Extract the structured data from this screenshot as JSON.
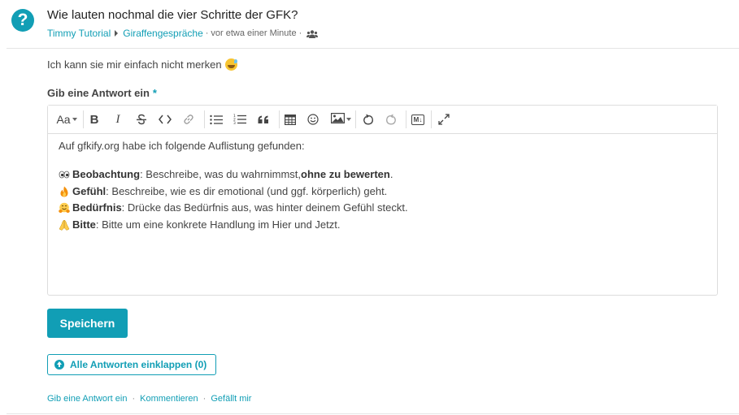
{
  "question": {
    "icon": "question-circle-icon",
    "title": "Wie lauten nochmal die vier Schritte der GFK?",
    "author": "Timmy Tutorial",
    "category": "Giraffengespräche",
    "time": "vor etwa einer Minute",
    "visibility_icon": "group-icon",
    "body": "Ich kann sie mir einfach nicht merken",
    "body_emoji": "grinning-sweat-emoji"
  },
  "answer_form": {
    "label": "Gib eine Antwort ein",
    "required_marker": "*",
    "toolbar": [
      {
        "name": "heading-dropdown",
        "label": "Aa"
      },
      {
        "name": "bold-icon"
      },
      {
        "name": "italic-icon"
      },
      {
        "name": "strikethrough-icon"
      },
      {
        "name": "code-icon"
      },
      {
        "name": "link-icon"
      },
      {
        "name": "bullet-list-icon"
      },
      {
        "name": "numbered-list-icon"
      },
      {
        "name": "quote-icon"
      },
      {
        "name": "table-icon"
      },
      {
        "name": "emoji-icon"
      },
      {
        "name": "image-icon"
      },
      {
        "name": "undo-icon"
      },
      {
        "name": "redo-icon"
      },
      {
        "name": "markdown-icon",
        "label": "M↓"
      },
      {
        "name": "fullscreen-icon"
      }
    ],
    "content": {
      "intro": "Auf gfkify.org habe ich folgende Auflistung gefunden:",
      "steps": [
        {
          "emoji": "eyes-emoji",
          "term": "Beobachtung",
          "text": ": Beschreibe, was du wahrnimmst, ",
          "bold_tail": "ohne zu bewerten",
          "end": "."
        },
        {
          "emoji": "fire-emoji",
          "term": "Gefühl",
          "text": ": Beschreibe, wie es dir emotional (und ggf. körperlich) geht.",
          "bold_tail": "",
          "end": ""
        },
        {
          "emoji": "hugging-emoji",
          "term": "Bedürfnis",
          "text": ": Drücke das Bedürfnis aus, was hinter deinem Gefühl steckt.",
          "bold_tail": "",
          "end": ""
        },
        {
          "emoji": "folded-hands-emoji",
          "term": "Bitte",
          "text": ": Bitte um eine konkrete Handlung im Hier und Jetzt.",
          "bold_tail": "",
          "end": ""
        }
      ]
    },
    "save_label": "Speichern"
  },
  "collapse_label": "Alle Antworten einklappen (0)",
  "footer": {
    "answer_link": "Gib eine Antwort ein",
    "comment_link": "Kommentieren",
    "like_link": "Gefällt mir",
    "separator": "·"
  },
  "colors": {
    "accent": "#119eb5",
    "text": "#444444",
    "border": "#dddddd"
  }
}
